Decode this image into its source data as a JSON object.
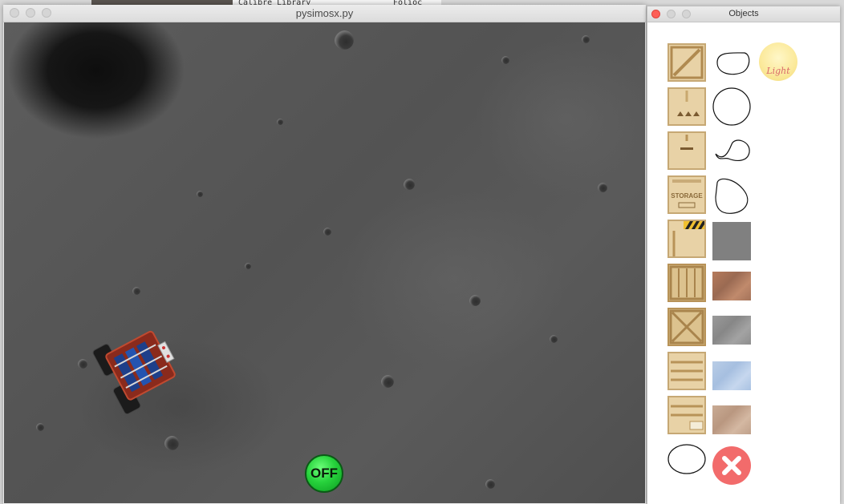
{
  "background_window": {
    "text_left": "Calibre Library",
    "text_right": "Folioc"
  },
  "main_window": {
    "title": "pysimosx.py",
    "power_button_label": "OFF"
  },
  "objects_window": {
    "title": "Objects",
    "light_label": "Light",
    "items": [
      {
        "name": "crate-cross-icon"
      },
      {
        "name": "blob-shape-icon"
      },
      {
        "name": "light-icon"
      },
      {
        "name": "box-arrows-icon"
      },
      {
        "name": "circle-shape-icon"
      },
      {
        "name": "box-plain-icon"
      },
      {
        "name": "loop-shape-icon"
      },
      {
        "name": "storage-box-icon"
      },
      {
        "name": "rounded-shape-icon"
      },
      {
        "name": "caution-box-icon"
      },
      {
        "name": "gray-square-icon"
      },
      {
        "name": "slat-crate-icon"
      },
      {
        "name": "rust-texture-icon"
      },
      {
        "name": "cross-crate-icon"
      },
      {
        "name": "stone-texture-icon"
      },
      {
        "name": "pallet-crate-icon"
      },
      {
        "name": "water-texture-icon"
      },
      {
        "name": "label-crate-icon"
      },
      {
        "name": "sand-texture-icon"
      },
      {
        "name": "ellipse-shape-icon"
      },
      {
        "name": "delete-icon"
      }
    ],
    "colors": {
      "gray_square": "#808080",
      "delete": "#f26b6b",
      "light": "#fbe99a"
    }
  }
}
